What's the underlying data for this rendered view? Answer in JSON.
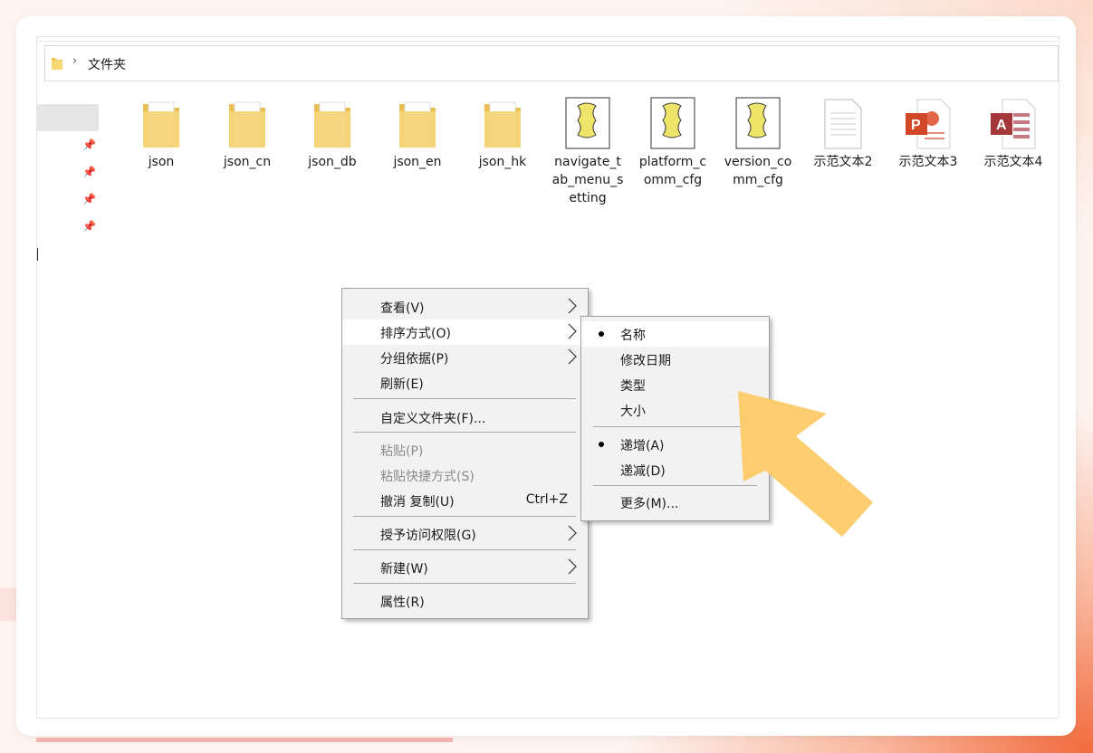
{
  "breadcrumb": {
    "current_folder": "文件夹"
  },
  "files": [
    {
      "name": "json",
      "type": "folder"
    },
    {
      "name": "json_cn",
      "type": "folder"
    },
    {
      "name": "json_db",
      "type": "folder"
    },
    {
      "name": "json_en",
      "type": "folder"
    },
    {
      "name": "json_hk",
      "type": "folder"
    },
    {
      "name": "navigate_tab_menu_setting",
      "type": "script"
    },
    {
      "name": "platform_comm_cfg",
      "type": "script"
    },
    {
      "name": "version_comm_cfg",
      "type": "script"
    },
    {
      "name": "示范文本2",
      "type": "text"
    },
    {
      "name": "示范文本3",
      "type": "powerpoint"
    },
    {
      "name": "示范文本4",
      "type": "access"
    }
  ],
  "context_menu": {
    "view": "查看(V)",
    "sort_by": "排序方式(O)",
    "group_by": "分组依据(P)",
    "refresh": "刷新(E)",
    "customize_folder": "自定义文件夹(F)...",
    "paste": "粘贴(P)",
    "paste_shortcut": "粘贴快捷方式(S)",
    "undo_copy": "撤消 复制(U)",
    "undo_shortcut": "Ctrl+Z",
    "give_access": "授予访问权限(G)",
    "new": "新建(W)",
    "properties": "属性(R)"
  },
  "sort_submenu": {
    "name": "名称",
    "date_modified": "修改日期",
    "type": "类型",
    "size": "大小",
    "ascending": "递增(A)",
    "descending": "递减(D)",
    "more": "更多(M)...",
    "selected_field": "名称",
    "selected_order": "递增(A)"
  },
  "colors": {
    "folder_yellow": "#f5d57a",
    "accent_arrow": "#fbcd6f",
    "menu_bg": "#f2f2f2",
    "background_orange": "#f26a3c"
  }
}
